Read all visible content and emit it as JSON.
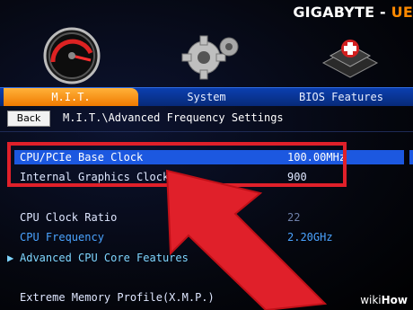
{
  "brand": {
    "name": "GIGABYTE",
    "dash": "-",
    "suffix": "UE"
  },
  "tabs": [
    {
      "label": "M.I.T.",
      "icon": "speedometer-icon",
      "active": true
    },
    {
      "label": "System",
      "icon": "gear-icon",
      "active": false
    },
    {
      "label": "BIOS Features",
      "icon": "chip-icon",
      "active": false
    }
  ],
  "breadcrumb": {
    "back_label": "Back",
    "path": "M.I.T.\\Advanced Frequency Settings"
  },
  "settings": [
    {
      "label": "CPU/PCIe Base Clock",
      "value": "100.00MHz",
      "selected": true
    },
    {
      "label": "Internal Graphics Clock",
      "value": "900"
    },
    {
      "label": "CPU Clock Ratio",
      "value": "22"
    },
    {
      "label": "CPU Frequency",
      "value": "2.20GHz"
    },
    {
      "label": "Advanced CPU Core Features",
      "value": ""
    },
    {
      "label": "Extreme Memory Profile(X.M.P.)",
      "value": ""
    }
  ],
  "annotation": {
    "box_color": "#e0202a",
    "arrow_color": "#e0202a"
  },
  "watermark": {
    "wiki": "wiki",
    "how": "How"
  },
  "colors": {
    "accent_orange": "#f07a00",
    "selection_blue": "#1c58e0",
    "link_blue": "#4aa3ff"
  }
}
